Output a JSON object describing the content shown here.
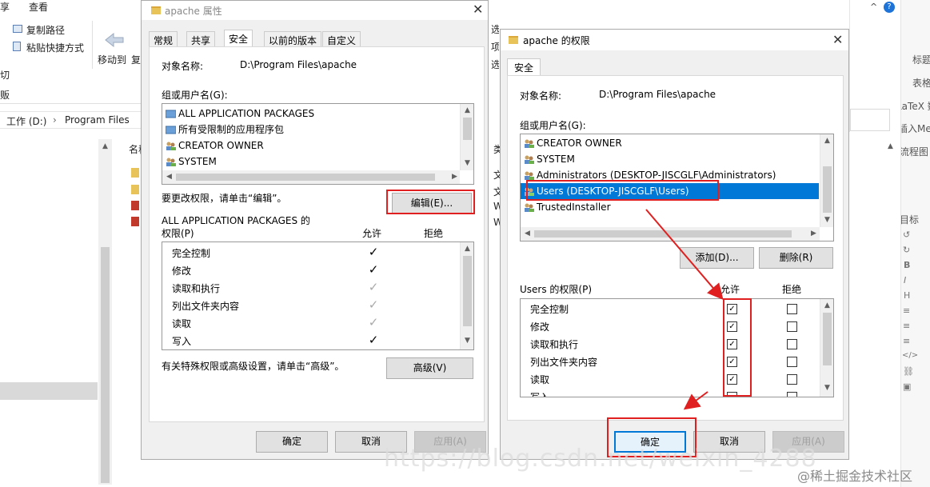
{
  "explorer": {
    "ribbon_tab_left": "享",
    "ribbon_tab_view": "查看",
    "copy_path": "复制路径",
    "paste_shortcut": "粘贴快捷方式",
    "move_to": "移动到",
    "copy_partial": "复",
    "left_cut1": "切",
    "left_cut2": "贩",
    "breadcrumb_drive": "工作 (D:)",
    "breadcrumb_sep": "›",
    "breadcrumb_folder": "Program Files",
    "col_name_partial": "名称",
    "right_fragments": [
      "选",
      "项",
      "选"
    ],
    "mid_fragments": [
      "类",
      "文",
      "文",
      "W",
      "W"
    ]
  },
  "props_dialog": {
    "title": "apache 属性",
    "tabs": [
      "常规",
      "共享",
      "安全",
      "以前的版本",
      "自定义"
    ],
    "selected_tab": "安全",
    "object_name_label": "对象名称:",
    "object_name_value": "D:\\Program Files\\apache",
    "group_label": "组或用户名(G):",
    "groups": [
      "ALL APPLICATION PACKAGES",
      "所有受限制的应用程序包",
      "CREATOR OWNER",
      "SYSTEM"
    ],
    "change_hint": "要更改权限，请单击“编辑”。",
    "edit_button": "编辑(E)...",
    "perm_title_line1": "ALL APPLICATION PACKAGES 的",
    "perm_title_line2": "权限(P)",
    "allow_header": "允许",
    "deny_header": "拒绝",
    "permissions": [
      {
        "name": "完全控制",
        "allow": "✓",
        "state": "granted"
      },
      {
        "name": "修改",
        "allow": "✓",
        "state": "granted"
      },
      {
        "name": "读取和执行",
        "allow": "✓",
        "state": "inherited"
      },
      {
        "name": "列出文件夹内容",
        "allow": "✓",
        "state": "inherited"
      },
      {
        "name": "读取",
        "allow": "✓",
        "state": "inherited"
      },
      {
        "name": "写入",
        "allow": "✓",
        "state": "granted"
      }
    ],
    "advanced_hint": "有关特殊权限或高级设置，请单击“高级”。",
    "advanced_button": "高级(V)",
    "ok_button": "确定",
    "cancel_button": "取消",
    "apply_button": "应用(A)"
  },
  "perm_dialog": {
    "title": "apache 的权限",
    "tab": "安全",
    "object_name_label": "对象名称:",
    "object_name_value": "D:\\Program Files\\apache",
    "group_label": "组或用户名(G):",
    "groups": [
      "CREATOR OWNER",
      "SYSTEM",
      "Administrators (DESKTOP-JISCGLF\\Administrators)",
      "Users (DESKTOP-JISCGLF\\Users)",
      "TrustedInstaller"
    ],
    "selected_group": "Users (DESKTOP-JISCGLF\\Users)",
    "add_button": "添加(D)...",
    "remove_button": "删除(R)",
    "perm_title": "Users 的权限(P)",
    "allow_header": "允许",
    "deny_header": "拒绝",
    "permissions": [
      {
        "name": "完全控制",
        "allow": true,
        "deny": false
      },
      {
        "name": "修改",
        "allow": true,
        "deny": false
      },
      {
        "name": "读取和执行",
        "allow": true,
        "deny": false
      },
      {
        "name": "列出文件夹内容",
        "allow": true,
        "deny": false
      },
      {
        "name": "读取",
        "allow": true,
        "deny": false
      },
      {
        "name": "写入",
        "allow": false,
        "deny": false
      }
    ],
    "ok_button": "确定",
    "cancel_button": "取消",
    "apply_button": "应用(A)"
  },
  "right_panel": {
    "items": [
      "标题",
      "表格",
      "LaTeX 数",
      "插入Me",
      "流程图",
      "目标"
    ]
  },
  "watermark": {
    "url_overlay": "https://blog.csdn.net/weixin_4288",
    "brand": "@稀土掘金技术社区"
  },
  "colors": {
    "highlight": "#e02020",
    "selection": "#0078d7"
  }
}
